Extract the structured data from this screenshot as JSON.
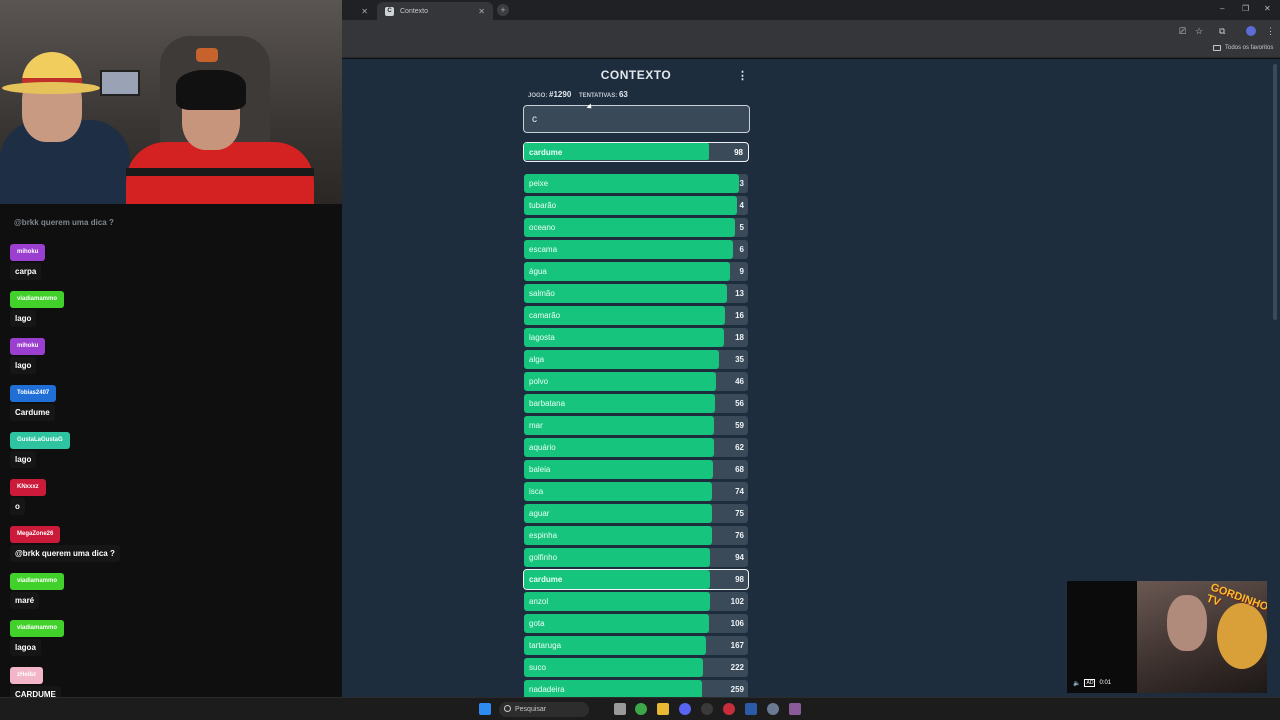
{
  "browser": {
    "tab_title": "Contexto",
    "tab_favicon": "C",
    "bookmark_folder": "Todos os favoritos"
  },
  "game": {
    "title": "CONTEXTO",
    "stats_label_game": "JOGO:",
    "game_number": "#1290",
    "stats_label_tries": "TENTATIVAS:",
    "tries": "63",
    "input_value": "c",
    "current_guess": {
      "word": "cardume",
      "rank": 98
    },
    "guesses": [
      {
        "word": "peixe",
        "rank": 3
      },
      {
        "word": "tubarão",
        "rank": 4
      },
      {
        "word": "oceano",
        "rank": 5
      },
      {
        "word": "escama",
        "rank": 6
      },
      {
        "word": "água",
        "rank": 9
      },
      {
        "word": "salmão",
        "rank": 13
      },
      {
        "word": "camarão",
        "rank": 16
      },
      {
        "word": "lagosta",
        "rank": 18
      },
      {
        "word": "alga",
        "rank": 35
      },
      {
        "word": "polvo",
        "rank": 46
      },
      {
        "word": "barbatana",
        "rank": 56
      },
      {
        "word": "mar",
        "rank": 59
      },
      {
        "word": "aquário",
        "rank": 62
      },
      {
        "word": "baleia",
        "rank": 68
      },
      {
        "word": "isca",
        "rank": 74
      },
      {
        "word": "aguar",
        "rank": 75
      },
      {
        "word": "espinha",
        "rank": 76
      },
      {
        "word": "golfinho",
        "rank": 94
      },
      {
        "word": "cardume",
        "rank": 98
      },
      {
        "word": "anzol",
        "rank": 102
      },
      {
        "word": "gota",
        "rank": 106
      },
      {
        "word": "tartaruga",
        "rank": 167
      },
      {
        "word": "suco",
        "rank": 222
      },
      {
        "word": "nadadeira",
        "rank": 259
      }
    ]
  },
  "chat": {
    "ghost_text": "@brkk querem uma dica ?",
    "messages": [
      {
        "user": "mihoku",
        "text": "carpa",
        "color": "#9b3fd0"
      },
      {
        "user": "viadiamammo",
        "text": "lago",
        "color": "#41d12a"
      },
      {
        "user": "mihoku",
        "text": "lago",
        "color": "#9b3fd0"
      },
      {
        "user": "Tobias2407",
        "text": "Cardume",
        "color": "#1f6fd6"
      },
      {
        "user": "GustaLaGustaG",
        "text": "lago",
        "color": "#2fc4a0"
      },
      {
        "user": "KNxxxz",
        "text": "o",
        "color": "#cc1a3a"
      },
      {
        "user": "MegaZone26",
        "text": "@brkk querem uma dica ?",
        "color": "#cc1a3a"
      },
      {
        "user": "viadiamammo",
        "text": "maré",
        "color": "#41d12a"
      },
      {
        "user": "viadiamammo",
        "text": "lagoa",
        "color": "#41d12a"
      },
      {
        "user": "zHeibz",
        "text": "CARDUME",
        "color": "#f3b6c8"
      }
    ]
  },
  "pip": {
    "time": "0:01",
    "ad_label": "AD",
    "brand": "GORDINHO TV"
  },
  "taskbar": {
    "search_placeholder": "Pesquisar"
  }
}
